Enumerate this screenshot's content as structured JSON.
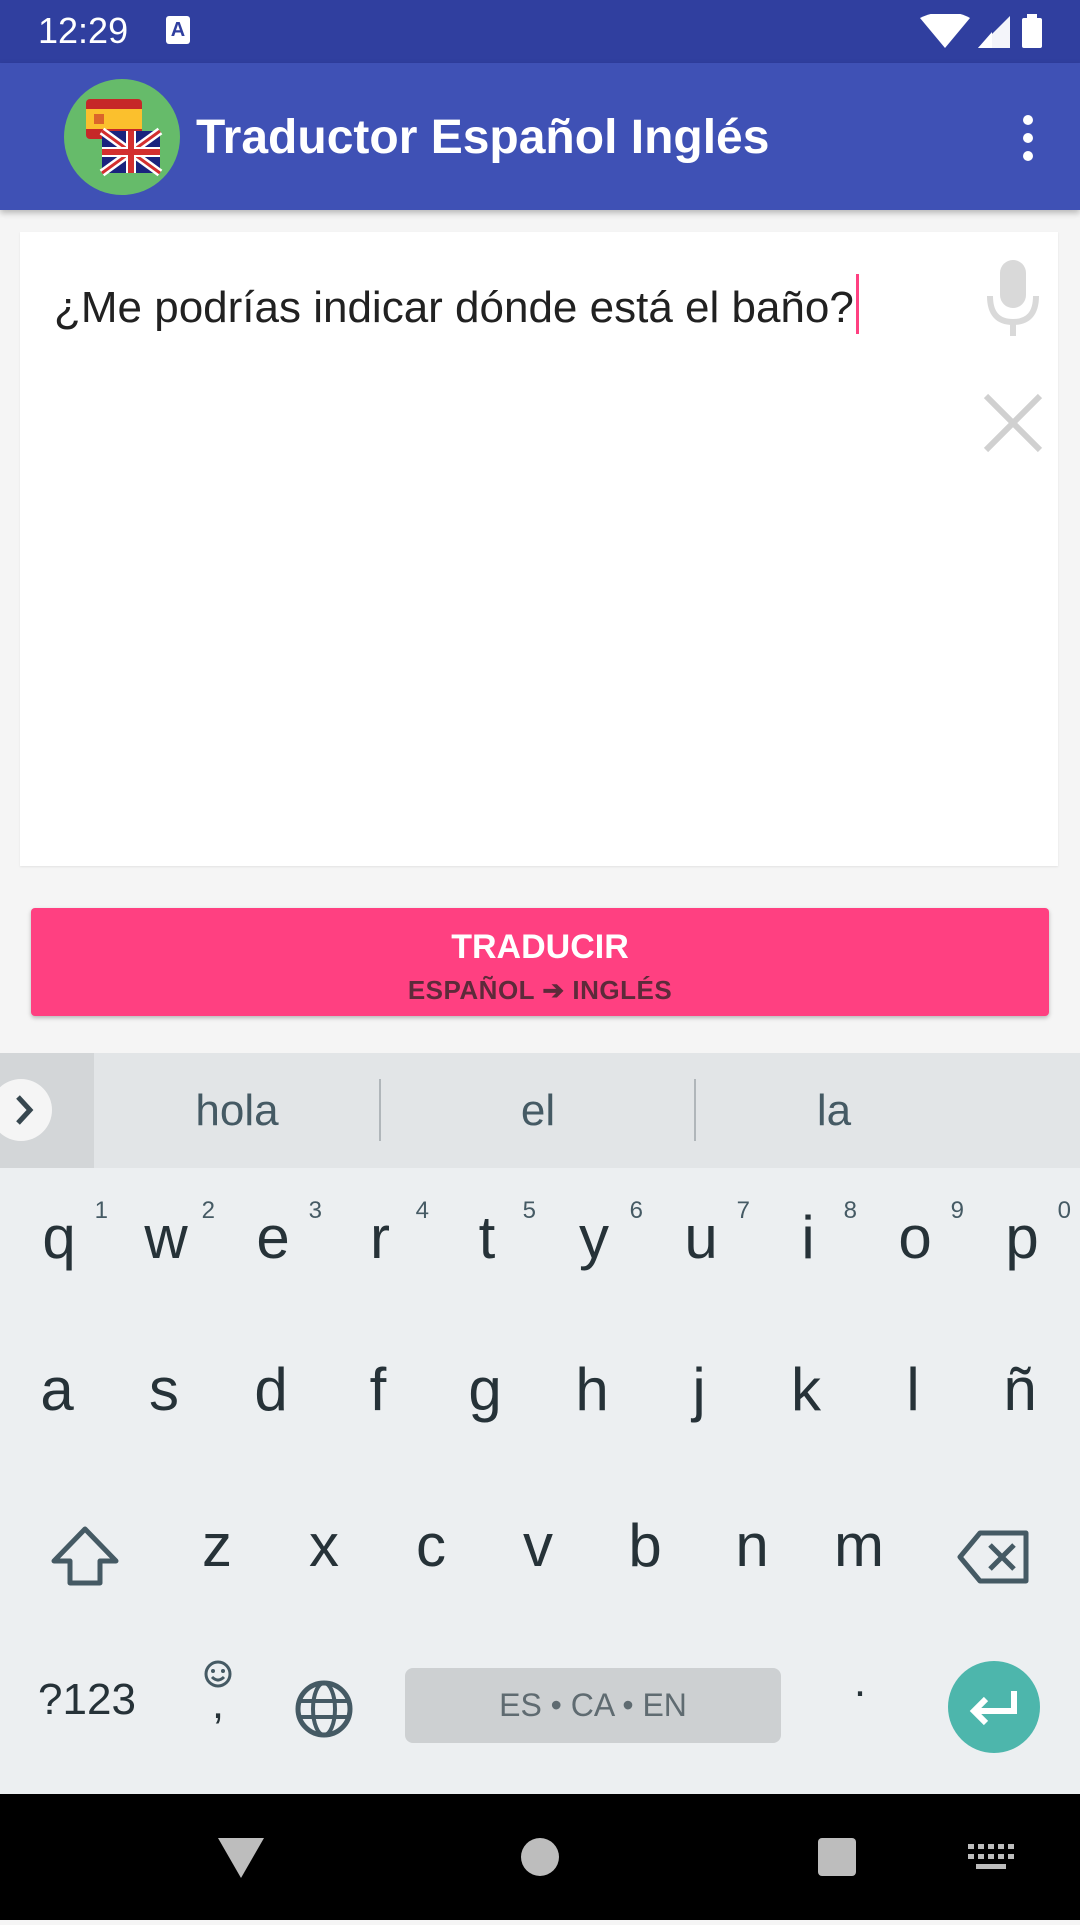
{
  "status_bar": {
    "time": "12:29",
    "notification_icon": "A",
    "icons": [
      "wifi-icon",
      "signal-icon",
      "battery-icon"
    ]
  },
  "app_bar": {
    "title": "Traductor Español Inglés",
    "logo": "flags-es-gb-icon",
    "menu_icon": "more-vert-icon"
  },
  "editor": {
    "text": "¿Me podrías indicar dónde está el baño?",
    "mic_icon": "mic-icon",
    "clear_icon": "close-icon"
  },
  "translate_button": {
    "label": "TRADUCIR",
    "direction_from": "ESPAÑOL",
    "direction_arrow": "➔",
    "direction_to": "INGLÉS"
  },
  "keyboard": {
    "suggestions": [
      "hola",
      "el",
      "la"
    ],
    "row1": [
      {
        "k": "q",
        "h": "1"
      },
      {
        "k": "w",
        "h": "2"
      },
      {
        "k": "e",
        "h": "3"
      },
      {
        "k": "r",
        "h": "4"
      },
      {
        "k": "t",
        "h": "5"
      },
      {
        "k": "y",
        "h": "6"
      },
      {
        "k": "u",
        "h": "7"
      },
      {
        "k": "i",
        "h": "8"
      },
      {
        "k": "o",
        "h": "9"
      },
      {
        "k": "p",
        "h": "0"
      }
    ],
    "row2": [
      "a",
      "s",
      "d",
      "f",
      "g",
      "h",
      "j",
      "k",
      "l",
      "ñ"
    ],
    "row3": [
      "z",
      "x",
      "c",
      "v",
      "b",
      "n",
      "m"
    ],
    "symbols_label": "?123",
    "comma_label": ",",
    "period_label": ".",
    "space_label": "ES • CA • EN"
  },
  "colors": {
    "primary_dark": "#303f9f",
    "primary": "#3f51b5",
    "accent": "#ff4081",
    "enter_key": "#4db6ac"
  }
}
